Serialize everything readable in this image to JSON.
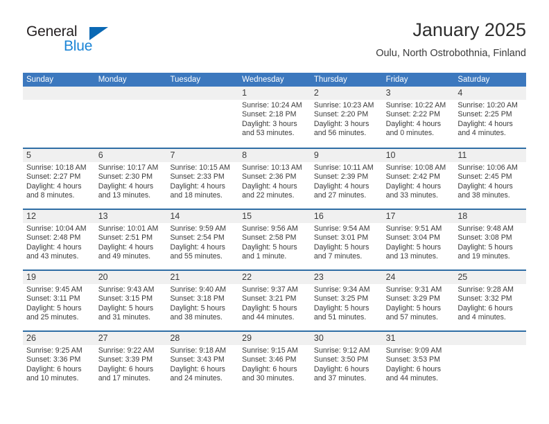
{
  "brand": {
    "name_part1": "General",
    "name_part2": "Blue",
    "triangle_color": "#0a68b4",
    "blue_color": "#1a84d6"
  },
  "header": {
    "title": "January 2025",
    "subtitle": "Oulu, North Ostrobothnia, Finland"
  },
  "theme": {
    "header_bar_color": "#3c78be",
    "week_divider_color": "#2e6da4",
    "daynum_band_color": "#f0f0f0",
    "text_color": "#3a3a3a"
  },
  "weekdays": [
    "Sunday",
    "Monday",
    "Tuesday",
    "Wednesday",
    "Thursday",
    "Friday",
    "Saturday"
  ],
  "weeks": [
    [
      {
        "day": "",
        "sunrise": "",
        "sunset": "",
        "daylight_line1": "",
        "daylight_line2": "",
        "empty": true
      },
      {
        "day": "",
        "sunrise": "",
        "sunset": "",
        "daylight_line1": "",
        "daylight_line2": "",
        "empty": true
      },
      {
        "day": "",
        "sunrise": "",
        "sunset": "",
        "daylight_line1": "",
        "daylight_line2": "",
        "empty": true
      },
      {
        "day": "1",
        "sunrise": "Sunrise: 10:24 AM",
        "sunset": "Sunset: 2:18 PM",
        "daylight_line1": "Daylight: 3 hours",
        "daylight_line2": "and 53 minutes.",
        "empty": false
      },
      {
        "day": "2",
        "sunrise": "Sunrise: 10:23 AM",
        "sunset": "Sunset: 2:20 PM",
        "daylight_line1": "Daylight: 3 hours",
        "daylight_line2": "and 56 minutes.",
        "empty": false
      },
      {
        "day": "3",
        "sunrise": "Sunrise: 10:22 AM",
        "sunset": "Sunset: 2:22 PM",
        "daylight_line1": "Daylight: 4 hours",
        "daylight_line2": "and 0 minutes.",
        "empty": false
      },
      {
        "day": "4",
        "sunrise": "Sunrise: 10:20 AM",
        "sunset": "Sunset: 2:25 PM",
        "daylight_line1": "Daylight: 4 hours",
        "daylight_line2": "and 4 minutes.",
        "empty": false
      }
    ],
    [
      {
        "day": "5",
        "sunrise": "Sunrise: 10:18 AM",
        "sunset": "Sunset: 2:27 PM",
        "daylight_line1": "Daylight: 4 hours",
        "daylight_line2": "and 8 minutes.",
        "empty": false
      },
      {
        "day": "6",
        "sunrise": "Sunrise: 10:17 AM",
        "sunset": "Sunset: 2:30 PM",
        "daylight_line1": "Daylight: 4 hours",
        "daylight_line2": "and 13 minutes.",
        "empty": false
      },
      {
        "day": "7",
        "sunrise": "Sunrise: 10:15 AM",
        "sunset": "Sunset: 2:33 PM",
        "daylight_line1": "Daylight: 4 hours",
        "daylight_line2": "and 18 minutes.",
        "empty": false
      },
      {
        "day": "8",
        "sunrise": "Sunrise: 10:13 AM",
        "sunset": "Sunset: 2:36 PM",
        "daylight_line1": "Daylight: 4 hours",
        "daylight_line2": "and 22 minutes.",
        "empty": false
      },
      {
        "day": "9",
        "sunrise": "Sunrise: 10:11 AM",
        "sunset": "Sunset: 2:39 PM",
        "daylight_line1": "Daylight: 4 hours",
        "daylight_line2": "and 27 minutes.",
        "empty": false
      },
      {
        "day": "10",
        "sunrise": "Sunrise: 10:08 AM",
        "sunset": "Sunset: 2:42 PM",
        "daylight_line1": "Daylight: 4 hours",
        "daylight_line2": "and 33 minutes.",
        "empty": false
      },
      {
        "day": "11",
        "sunrise": "Sunrise: 10:06 AM",
        "sunset": "Sunset: 2:45 PM",
        "daylight_line1": "Daylight: 4 hours",
        "daylight_line2": "and 38 minutes.",
        "empty": false
      }
    ],
    [
      {
        "day": "12",
        "sunrise": "Sunrise: 10:04 AM",
        "sunset": "Sunset: 2:48 PM",
        "daylight_line1": "Daylight: 4 hours",
        "daylight_line2": "and 43 minutes.",
        "empty": false
      },
      {
        "day": "13",
        "sunrise": "Sunrise: 10:01 AM",
        "sunset": "Sunset: 2:51 PM",
        "daylight_line1": "Daylight: 4 hours",
        "daylight_line2": "and 49 minutes.",
        "empty": false
      },
      {
        "day": "14",
        "sunrise": "Sunrise: 9:59 AM",
        "sunset": "Sunset: 2:54 PM",
        "daylight_line1": "Daylight: 4 hours",
        "daylight_line2": "and 55 minutes.",
        "empty": false
      },
      {
        "day": "15",
        "sunrise": "Sunrise: 9:56 AM",
        "sunset": "Sunset: 2:58 PM",
        "daylight_line1": "Daylight: 5 hours",
        "daylight_line2": "and 1 minute.",
        "empty": false
      },
      {
        "day": "16",
        "sunrise": "Sunrise: 9:54 AM",
        "sunset": "Sunset: 3:01 PM",
        "daylight_line1": "Daylight: 5 hours",
        "daylight_line2": "and 7 minutes.",
        "empty": false
      },
      {
        "day": "17",
        "sunrise": "Sunrise: 9:51 AM",
        "sunset": "Sunset: 3:04 PM",
        "daylight_line1": "Daylight: 5 hours",
        "daylight_line2": "and 13 minutes.",
        "empty": false
      },
      {
        "day": "18",
        "sunrise": "Sunrise: 9:48 AM",
        "sunset": "Sunset: 3:08 PM",
        "daylight_line1": "Daylight: 5 hours",
        "daylight_line2": "and 19 minutes.",
        "empty": false
      }
    ],
    [
      {
        "day": "19",
        "sunrise": "Sunrise: 9:45 AM",
        "sunset": "Sunset: 3:11 PM",
        "daylight_line1": "Daylight: 5 hours",
        "daylight_line2": "and 25 minutes.",
        "empty": false
      },
      {
        "day": "20",
        "sunrise": "Sunrise: 9:43 AM",
        "sunset": "Sunset: 3:15 PM",
        "daylight_line1": "Daylight: 5 hours",
        "daylight_line2": "and 31 minutes.",
        "empty": false
      },
      {
        "day": "21",
        "sunrise": "Sunrise: 9:40 AM",
        "sunset": "Sunset: 3:18 PM",
        "daylight_line1": "Daylight: 5 hours",
        "daylight_line2": "and 38 minutes.",
        "empty": false
      },
      {
        "day": "22",
        "sunrise": "Sunrise: 9:37 AM",
        "sunset": "Sunset: 3:21 PM",
        "daylight_line1": "Daylight: 5 hours",
        "daylight_line2": "and 44 minutes.",
        "empty": false
      },
      {
        "day": "23",
        "sunrise": "Sunrise: 9:34 AM",
        "sunset": "Sunset: 3:25 PM",
        "daylight_line1": "Daylight: 5 hours",
        "daylight_line2": "and 51 minutes.",
        "empty": false
      },
      {
        "day": "24",
        "sunrise": "Sunrise: 9:31 AM",
        "sunset": "Sunset: 3:29 PM",
        "daylight_line1": "Daylight: 5 hours",
        "daylight_line2": "and 57 minutes.",
        "empty": false
      },
      {
        "day": "25",
        "sunrise": "Sunrise: 9:28 AM",
        "sunset": "Sunset: 3:32 PM",
        "daylight_line1": "Daylight: 6 hours",
        "daylight_line2": "and 4 minutes.",
        "empty": false
      }
    ],
    [
      {
        "day": "26",
        "sunrise": "Sunrise: 9:25 AM",
        "sunset": "Sunset: 3:36 PM",
        "daylight_line1": "Daylight: 6 hours",
        "daylight_line2": "and 10 minutes.",
        "empty": false
      },
      {
        "day": "27",
        "sunrise": "Sunrise: 9:22 AM",
        "sunset": "Sunset: 3:39 PM",
        "daylight_line1": "Daylight: 6 hours",
        "daylight_line2": "and 17 minutes.",
        "empty": false
      },
      {
        "day": "28",
        "sunrise": "Sunrise: 9:18 AM",
        "sunset": "Sunset: 3:43 PM",
        "daylight_line1": "Daylight: 6 hours",
        "daylight_line2": "and 24 minutes.",
        "empty": false
      },
      {
        "day": "29",
        "sunrise": "Sunrise: 9:15 AM",
        "sunset": "Sunset: 3:46 PM",
        "daylight_line1": "Daylight: 6 hours",
        "daylight_line2": "and 30 minutes.",
        "empty": false
      },
      {
        "day": "30",
        "sunrise": "Sunrise: 9:12 AM",
        "sunset": "Sunset: 3:50 PM",
        "daylight_line1": "Daylight: 6 hours",
        "daylight_line2": "and 37 minutes.",
        "empty": false
      },
      {
        "day": "31",
        "sunrise": "Sunrise: 9:09 AM",
        "sunset": "Sunset: 3:53 PM",
        "daylight_line1": "Daylight: 6 hours",
        "daylight_line2": "and 44 minutes.",
        "empty": false
      },
      {
        "day": "",
        "sunrise": "",
        "sunset": "",
        "daylight_line1": "",
        "daylight_line2": "",
        "empty": true
      }
    ]
  ]
}
